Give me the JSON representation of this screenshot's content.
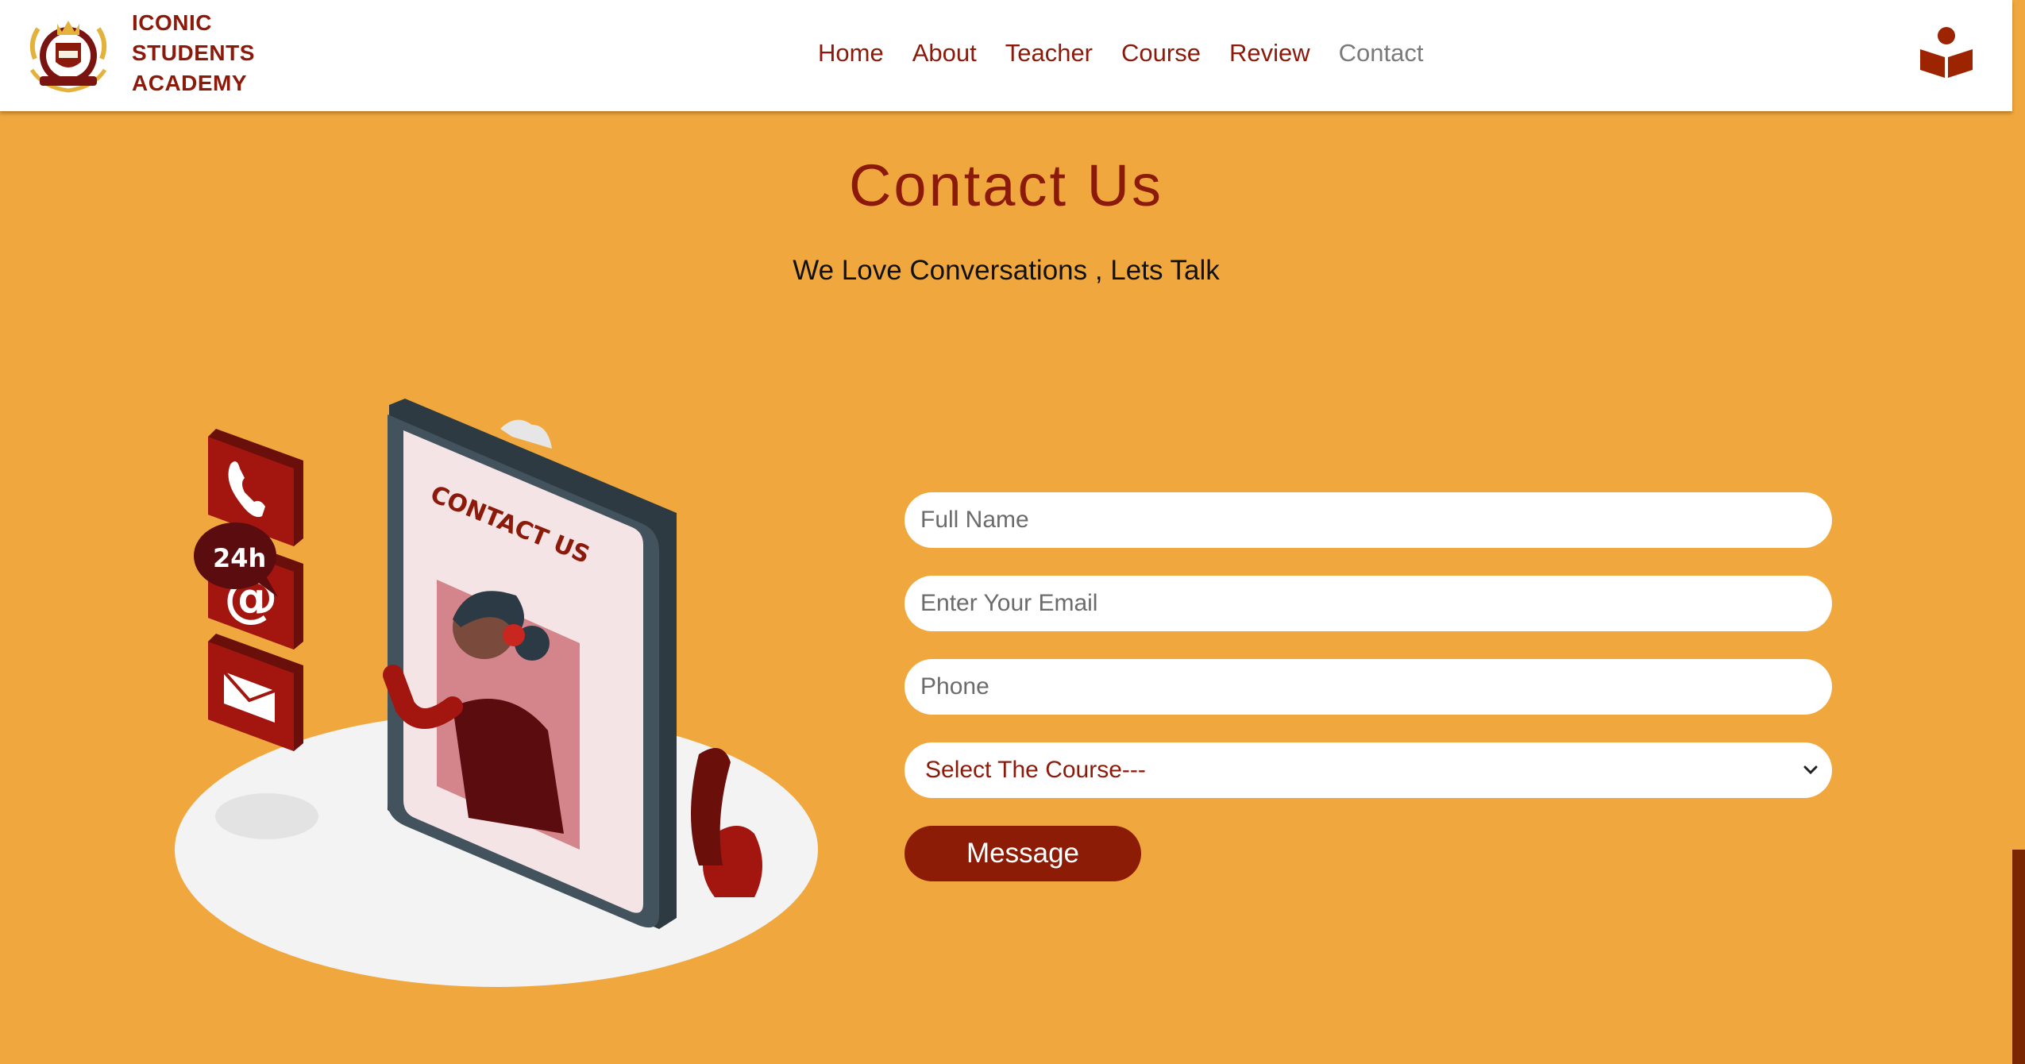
{
  "header": {
    "logo_lines": [
      "ICONIC",
      "STUDENTS",
      "ACADEMY"
    ],
    "nav": [
      {
        "label": "Home"
      },
      {
        "label": "About"
      },
      {
        "label": "Teacher"
      },
      {
        "label": "Course"
      },
      {
        "label": "Review"
      },
      {
        "label": "Contact",
        "active": true
      }
    ],
    "reader_icon": "book-reader-icon"
  },
  "contact": {
    "title": "Contact Us",
    "subtitle": "We Love Conversations , Lets Talk",
    "illustration": {
      "phone_screen_text": "CONTACT US",
      "badge_text": "24h"
    },
    "form": {
      "full_name_placeholder": "Full Name",
      "email_placeholder": "Enter Your Email",
      "phone_placeholder": "Phone",
      "course_select": "Select The Course---",
      "submit_label": "Message"
    }
  },
  "colors": {
    "page_background": "#f0a83e",
    "brand_red": "#8b1a0a",
    "button": "#8c1c06",
    "nav_active": "#7a7a7a"
  }
}
